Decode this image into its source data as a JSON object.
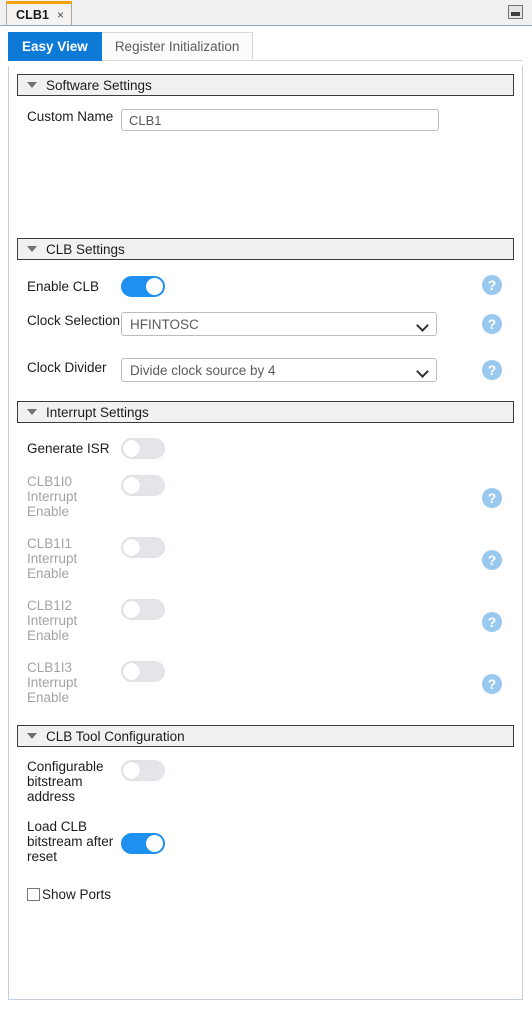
{
  "window": {
    "tab_title": "CLB1",
    "tab_close": "×",
    "minimize_label": ""
  },
  "view_tabs": [
    {
      "label": "Easy View",
      "active": true
    },
    {
      "label": "Register Initialization",
      "active": false
    }
  ],
  "help_glyph": "?",
  "sections": [
    {
      "id": "software-settings",
      "title": "Software Settings",
      "rows": [
        {
          "type": "text",
          "label": "Custom Name",
          "value": "CLB1",
          "placeholder": "CLB1",
          "help": false
        }
      ]
    },
    {
      "id": "clb-settings",
      "title": "CLB Settings",
      "rows": [
        {
          "type": "toggle",
          "label": "Enable CLB",
          "state": "on",
          "help": true,
          "disabled": false
        },
        {
          "type": "select",
          "label": "Clock Selection",
          "value": "HFINTOSC",
          "help": true,
          "disabled": false
        },
        {
          "type": "select",
          "label": "Clock Divider",
          "value": "Divide clock source by 4",
          "help": true,
          "disabled": false
        }
      ]
    },
    {
      "id": "interrupt-settings",
      "title": "Interrupt Settings",
      "rows": [
        {
          "type": "toggle",
          "label": "Generate ISR",
          "state": "off",
          "help": false,
          "disabled": false
        },
        {
          "type": "toggle",
          "label": "CLB1I0 Interrupt Enable",
          "state": "off",
          "help": true,
          "disabled": true
        },
        {
          "type": "toggle",
          "label": "CLB1I1 Interrupt Enable",
          "state": "off",
          "help": true,
          "disabled": true
        },
        {
          "type": "toggle",
          "label": "CLB1I2 Interrupt Enable",
          "state": "off",
          "help": true,
          "disabled": true
        },
        {
          "type": "toggle",
          "label": "CLB1I3 Interrupt Enable",
          "state": "off",
          "help": true,
          "disabled": true
        }
      ]
    },
    {
      "id": "clb-tool-configuration",
      "title": "CLB Tool Configuration",
      "rows": [
        {
          "type": "toggle",
          "label": "Configurable bitstream address",
          "state": "off",
          "help": false,
          "disabled": false
        },
        {
          "type": "toggle",
          "label": "Load CLB bitstream after reset",
          "state": "on",
          "help": false,
          "disabled": false
        }
      ]
    }
  ],
  "footer": {
    "show_ports_label": "Show Ports",
    "show_ports_checked": false
  },
  "colors": {
    "accent_blue": "#1e90f0",
    "tab_active_blue": "#0d7ad8",
    "tab_top_orange": "#f0a30a",
    "help_blue": "#9ac9ef",
    "disabled_text": "#a3a3a3"
  }
}
